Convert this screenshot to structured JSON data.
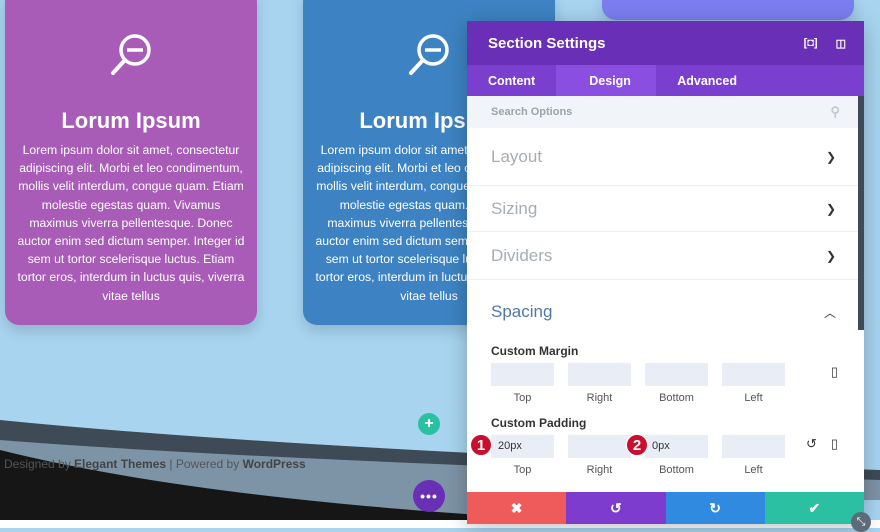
{
  "cards": [
    {
      "title": "Lorum Ipsum",
      "body": "Lorem ipsum dolor sit amet, consectetur adipiscing elit. Morbi et leo condimentum, mollis velit interdum, congue quam. Etiam molestie egestas quam. Vivamus maximus viverra pellentesque. Donec auctor enim sed dictum semper. Integer id sem ut tortor scelerisque luctus. Etiam tortor eros, interdum in luctus quis, viverra vitae tellus",
      "color": "#a95bb8",
      "icon": "zoom-out-icon"
    },
    {
      "title": "Lorum Ipsum",
      "body": "Lorem ipsum dolor sit amet, consectetur adipiscing elit. Morbi et leo condimentum, mollis velit interdum, congue quam. Etiam molestie egestas quam. Vivamus maximus viverra pellentesque. Donec auctor enim sed dictum semper. Integer id sem ut tortor scelerisque luctus. Etiam tortor eros, interdum in luctus quis, viverra vitae tellus",
      "color": "#3d83c3",
      "icon": "zoom-out-icon"
    }
  ],
  "footer": {
    "prefix": "Designed by ",
    "brand": "Elegant Themes",
    "mid": " | Powered by ",
    "platform": "WordPress"
  },
  "builder": {
    "add_label": "+",
    "menu_label": "•••"
  },
  "panel": {
    "title": "Section Settings",
    "tabs": [
      "Content",
      "Design",
      "Advanced"
    ],
    "active_tab": "Design",
    "search_placeholder": "Search Options",
    "sections": [
      "Layout",
      "Sizing",
      "Dividers",
      "Spacing"
    ],
    "open_section": "Spacing",
    "margin": {
      "label": "Custom Margin",
      "fields": [
        {
          "label": "Top",
          "value": ""
        },
        {
          "label": "Right",
          "value": ""
        },
        {
          "label": "Bottom",
          "value": ""
        },
        {
          "label": "Left",
          "value": ""
        }
      ]
    },
    "padding": {
      "label": "Custom Padding",
      "fields": [
        {
          "label": "Top",
          "value": "20px"
        },
        {
          "label": "Right",
          "value": ""
        },
        {
          "label": "Bottom",
          "value": "0px"
        },
        {
          "label": "Left",
          "value": ""
        }
      ]
    },
    "annotations": [
      "1",
      "2"
    ],
    "footer_colors": {
      "cancel": "#ef5a5a",
      "undo": "#7e3ccf",
      "redo": "#2f8ae0",
      "save": "#2bc0a2"
    }
  }
}
